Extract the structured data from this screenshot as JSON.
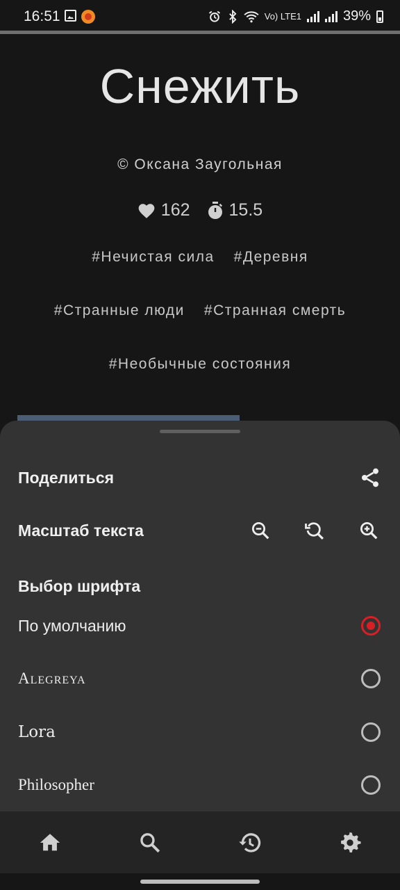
{
  "status_bar": {
    "time": "16:51",
    "network_label": "Vo) LTE1",
    "battery": "39%"
  },
  "story": {
    "title": "Снежить",
    "author": "© Оксана Заугольная",
    "likes": "162",
    "read_time": "15.5",
    "tag_rows": [
      [
        "#Нечистая сила",
        "#Деревня"
      ],
      [
        "#Странные люди",
        "#Странная смерть"
      ],
      [
        "#Необычные состояния"
      ]
    ]
  },
  "sheet": {
    "share_label": "Поделиться",
    "scale_label": "Масштаб текста",
    "font_section_title": "Выбор шрифта",
    "fonts": [
      {
        "label": "По умолчанию",
        "selected": true
      },
      {
        "label": "Alegreya",
        "selected": false
      },
      {
        "label": "Lora",
        "selected": false
      },
      {
        "label": "Philosopher",
        "selected": false
      }
    ]
  },
  "icons": {
    "share": "share-icon",
    "zoom_out": "zoom-out-icon",
    "zoom_reset": "zoom-reset-icon",
    "zoom_in": "zoom-in-icon",
    "nav": [
      "home-icon",
      "search-icon",
      "history-icon",
      "settings-icon"
    ]
  },
  "colors": {
    "background": "#161616",
    "sheet": "#333333",
    "accent": "#d81f26",
    "navbar": "#242424"
  }
}
